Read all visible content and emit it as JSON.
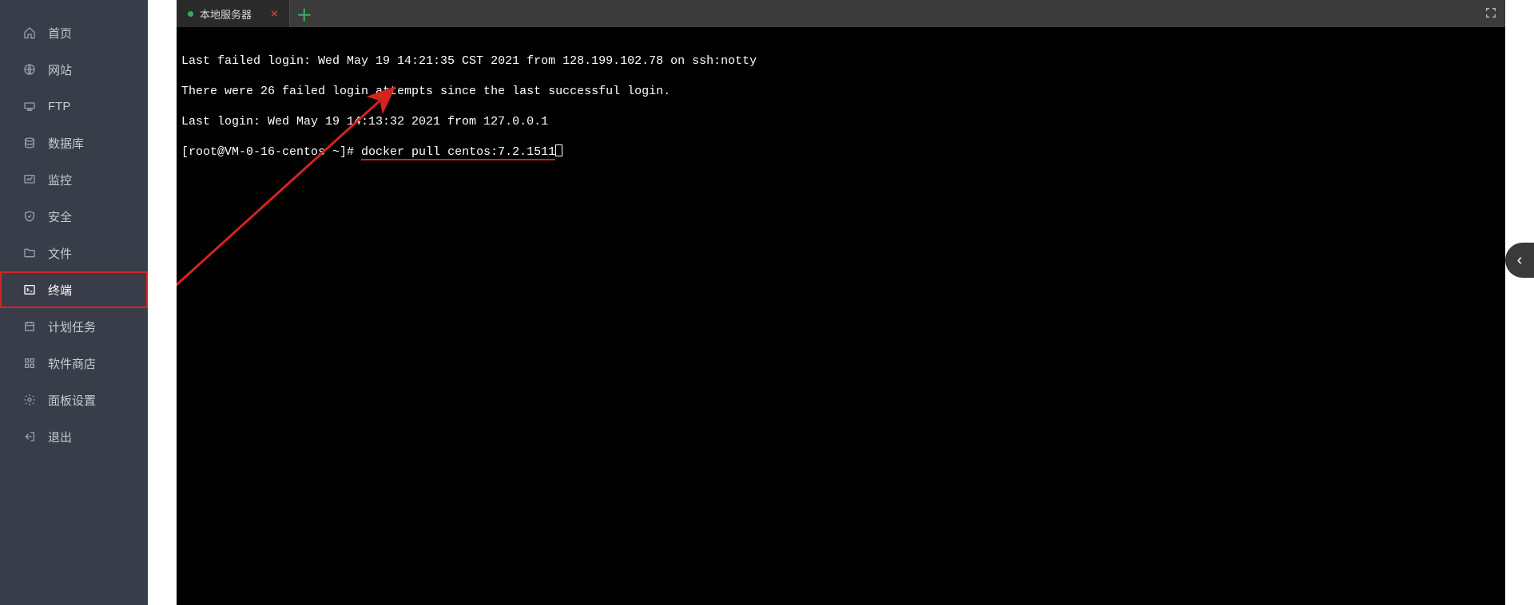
{
  "sidebar": {
    "items": [
      {
        "label": "首页",
        "icon": "home-icon"
      },
      {
        "label": "网站",
        "icon": "globe-icon"
      },
      {
        "label": "FTP",
        "icon": "ftp-icon"
      },
      {
        "label": "数据库",
        "icon": "database-icon"
      },
      {
        "label": "监控",
        "icon": "monitor-icon"
      },
      {
        "label": "安全",
        "icon": "shield-icon"
      },
      {
        "label": "文件",
        "icon": "folder-icon"
      },
      {
        "label": "终端",
        "icon": "terminal-icon",
        "active": true
      },
      {
        "label": "计划任务",
        "icon": "tasks-icon"
      },
      {
        "label": "软件商店",
        "icon": "apps-icon"
      },
      {
        "label": "面板设置",
        "icon": "settings-icon"
      },
      {
        "label": "退出",
        "icon": "logout-icon"
      }
    ]
  },
  "tabs": {
    "items": [
      {
        "label": "本地服务器",
        "status_color": "#2fb158"
      }
    ],
    "close_glyph": "×",
    "add_glyph": "＋"
  },
  "terminal": {
    "lines": [
      "Last failed login: Wed May 19 14:21:35 CST 2021 from 128.199.102.78 on ssh:notty",
      "There were 26 failed login attempts since the last successful login.",
      "Last login: Wed May 19 14:13:32 2021 from 127.0.0.1"
    ],
    "prompt": "[root@VM-0-16-centos ~]# ",
    "command": "docker pull centos:7.2.1511"
  },
  "side_handle_glyph": "‹",
  "annotation": {
    "color": "#d6231f"
  }
}
